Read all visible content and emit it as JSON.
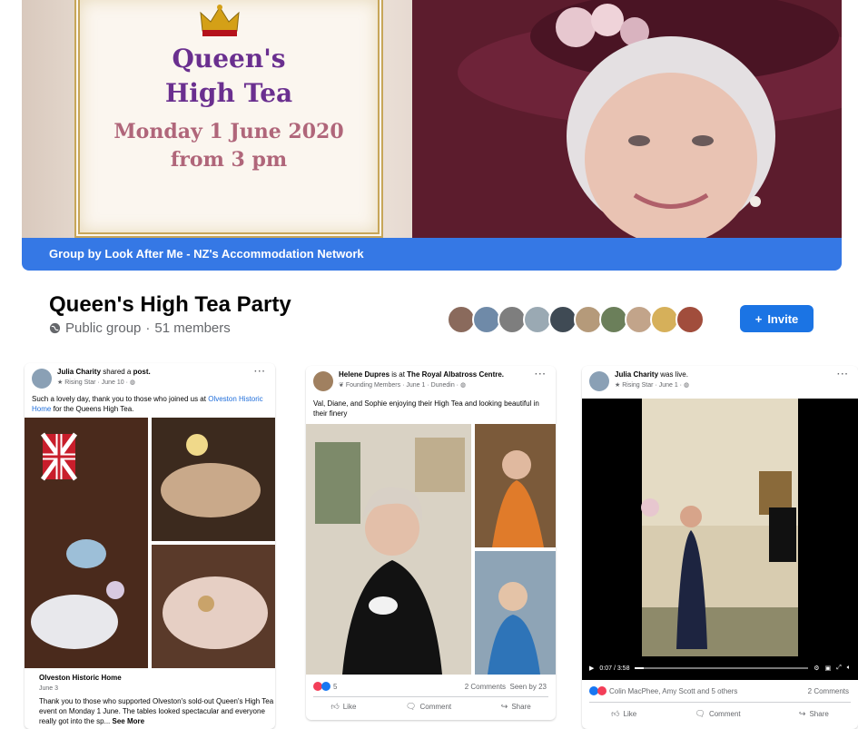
{
  "cover": {
    "title_line1": "Queen's",
    "title_line2": "High Tea",
    "date_line": "Monday 1 June 2020",
    "time_line": "from 3 pm",
    "group_by": "Group by Look After Me - NZ's Accommodation Network"
  },
  "header": {
    "group_name": "Queen's High Tea Party",
    "privacy": "Public group",
    "separator": "·",
    "members": "51 members",
    "invite_label": "Invite"
  },
  "avatar_colors": [
    "#8a6a5c",
    "#6f8aa8",
    "#7e7e7e",
    "#9aa9b3",
    "#3f4a54",
    "#b59a7a",
    "#6b7f5a",
    "#c2a48a",
    "#d6b05a",
    "#a14d3c"
  ],
  "posts": [
    {
      "author": "Julia Charity",
      "action": "shared a",
      "target": "post.",
      "badge": "Rising Star",
      "date": "June 10",
      "text_prefix": "Such a lovely day, thank you to those who joined us at",
      "text_link": "Olveston Historic Home",
      "text_suffix": "for the Queens High Tea.",
      "link_title": "Olveston Historic Home",
      "link_date": "June 3",
      "link_body": "Thank you to those who supported Olveston's sold-out Queen's High Tea event on Monday 1 June.  The tables looked spectacular and everyone really got into the sp...",
      "see_more": "See More"
    },
    {
      "author": "Helene Dupres",
      "action": "is at",
      "target": "The Royal Albatross Centre.",
      "badge": "Founding Members",
      "date": "June 1",
      "location": "Dunedin",
      "text": "Val, Diane, and Sophie enjoying their High Tea and looking beautiful in their finery",
      "reaction_count": "5",
      "comments": "2 Comments",
      "seen": "Seen by 23",
      "like_label": "Like",
      "comment_label": "Comment",
      "share_label": "Share"
    },
    {
      "author": "Julia Charity",
      "action": "was live.",
      "badge": "Rising Star",
      "date": "June 1",
      "time": "0:07 / 3:58",
      "reactors": "Colin MacPhee, Amy Scott and 5 others",
      "comments": "2 Comments",
      "like_label": "Like",
      "comment_label": "Comment",
      "share_label": "Share"
    }
  ],
  "more_icon": "···"
}
